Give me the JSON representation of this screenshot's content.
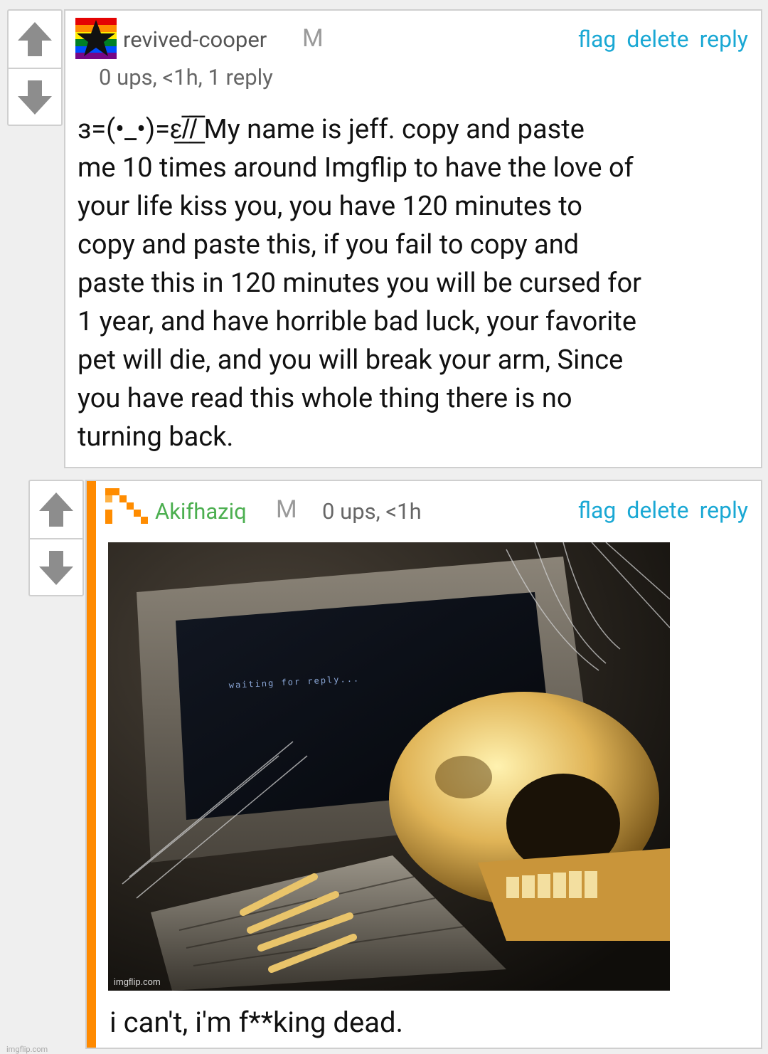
{
  "comment1": {
    "username": "revived-cooper",
    "badge": "M",
    "meta": "0 ups, <1h, 1 reply",
    "actions": {
      "flag": "flag",
      "delete": "delete",
      "reply": "reply"
    },
    "body_lines": [
      "з=(•_•)=ε̲/̅/̲̅̅ My name is jeff. copy and paste",
      "me 10 times around Imgflip to have the love of",
      "your life kiss you, you have 120 minutes to",
      "copy and paste this, if you fail to copy and",
      "paste this in 120 minutes you will be cursed for",
      "1 year, and have horrible bad luck, your favorite",
      "pet will die, and you will break your arm, Since",
      "you have read this whole thing there is no",
      "turning back."
    ],
    "avatar_colors": [
      "#e40303",
      "#ff8c00",
      "#ffed00",
      "#008026",
      "#004dff",
      "#750787"
    ]
  },
  "comment2": {
    "username": "Akifhaziq",
    "username_color": "#4caf50",
    "badge": "M",
    "meta": "0 ups, <1h",
    "actions": {
      "flag": "flag",
      "delete": "delete",
      "reply": "reply"
    },
    "image": {
      "screen_text": "waiting for reply...",
      "watermark": "imgflip.com"
    },
    "caption": "i can't, i'm f**king dead."
  },
  "page_watermark": "imgflip.com",
  "colors": {
    "link": "#1aa8d4",
    "reply_bar": "#ff8a00"
  }
}
